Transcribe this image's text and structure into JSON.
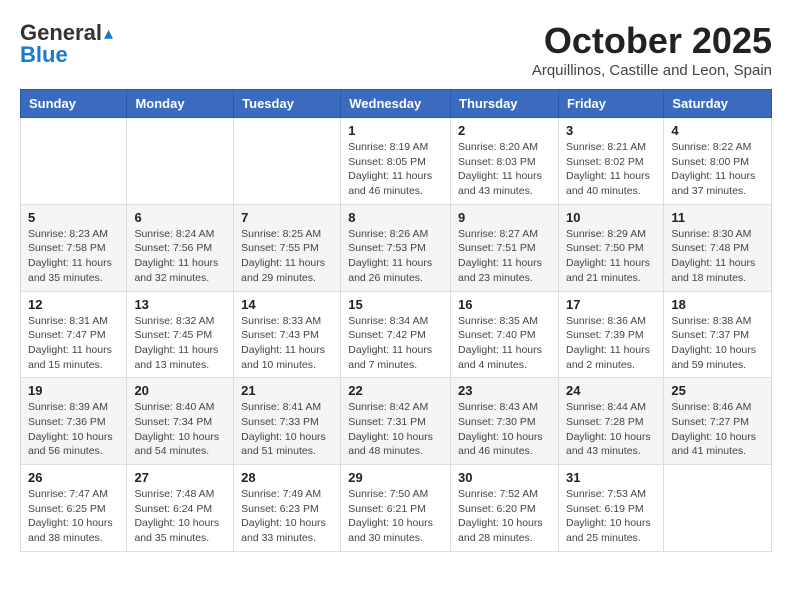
{
  "header": {
    "logo_general": "General",
    "logo_blue": "Blue",
    "month_title": "October 2025",
    "location": "Arquillinos, Castille and Leon, Spain"
  },
  "weekdays": [
    "Sunday",
    "Monday",
    "Tuesday",
    "Wednesday",
    "Thursday",
    "Friday",
    "Saturday"
  ],
  "weeks": [
    [
      {
        "day": "",
        "info": ""
      },
      {
        "day": "",
        "info": ""
      },
      {
        "day": "",
        "info": ""
      },
      {
        "day": "1",
        "info": "Sunrise: 8:19 AM\nSunset: 8:05 PM\nDaylight: 11 hours and 46 minutes."
      },
      {
        "day": "2",
        "info": "Sunrise: 8:20 AM\nSunset: 8:03 PM\nDaylight: 11 hours and 43 minutes."
      },
      {
        "day": "3",
        "info": "Sunrise: 8:21 AM\nSunset: 8:02 PM\nDaylight: 11 hours and 40 minutes."
      },
      {
        "day": "4",
        "info": "Sunrise: 8:22 AM\nSunset: 8:00 PM\nDaylight: 11 hours and 37 minutes."
      }
    ],
    [
      {
        "day": "5",
        "info": "Sunrise: 8:23 AM\nSunset: 7:58 PM\nDaylight: 11 hours and 35 minutes."
      },
      {
        "day": "6",
        "info": "Sunrise: 8:24 AM\nSunset: 7:56 PM\nDaylight: 11 hours and 32 minutes."
      },
      {
        "day": "7",
        "info": "Sunrise: 8:25 AM\nSunset: 7:55 PM\nDaylight: 11 hours and 29 minutes."
      },
      {
        "day": "8",
        "info": "Sunrise: 8:26 AM\nSunset: 7:53 PM\nDaylight: 11 hours and 26 minutes."
      },
      {
        "day": "9",
        "info": "Sunrise: 8:27 AM\nSunset: 7:51 PM\nDaylight: 11 hours and 23 minutes."
      },
      {
        "day": "10",
        "info": "Sunrise: 8:29 AM\nSunset: 7:50 PM\nDaylight: 11 hours and 21 minutes."
      },
      {
        "day": "11",
        "info": "Sunrise: 8:30 AM\nSunset: 7:48 PM\nDaylight: 11 hours and 18 minutes."
      }
    ],
    [
      {
        "day": "12",
        "info": "Sunrise: 8:31 AM\nSunset: 7:47 PM\nDaylight: 11 hours and 15 minutes."
      },
      {
        "day": "13",
        "info": "Sunrise: 8:32 AM\nSunset: 7:45 PM\nDaylight: 11 hours and 13 minutes."
      },
      {
        "day": "14",
        "info": "Sunrise: 8:33 AM\nSunset: 7:43 PM\nDaylight: 11 hours and 10 minutes."
      },
      {
        "day": "15",
        "info": "Sunrise: 8:34 AM\nSunset: 7:42 PM\nDaylight: 11 hours and 7 minutes."
      },
      {
        "day": "16",
        "info": "Sunrise: 8:35 AM\nSunset: 7:40 PM\nDaylight: 11 hours and 4 minutes."
      },
      {
        "day": "17",
        "info": "Sunrise: 8:36 AM\nSunset: 7:39 PM\nDaylight: 11 hours and 2 minutes."
      },
      {
        "day": "18",
        "info": "Sunrise: 8:38 AM\nSunset: 7:37 PM\nDaylight: 10 hours and 59 minutes."
      }
    ],
    [
      {
        "day": "19",
        "info": "Sunrise: 8:39 AM\nSunset: 7:36 PM\nDaylight: 10 hours and 56 minutes."
      },
      {
        "day": "20",
        "info": "Sunrise: 8:40 AM\nSunset: 7:34 PM\nDaylight: 10 hours and 54 minutes."
      },
      {
        "day": "21",
        "info": "Sunrise: 8:41 AM\nSunset: 7:33 PM\nDaylight: 10 hours and 51 minutes."
      },
      {
        "day": "22",
        "info": "Sunrise: 8:42 AM\nSunset: 7:31 PM\nDaylight: 10 hours and 48 minutes."
      },
      {
        "day": "23",
        "info": "Sunrise: 8:43 AM\nSunset: 7:30 PM\nDaylight: 10 hours and 46 minutes."
      },
      {
        "day": "24",
        "info": "Sunrise: 8:44 AM\nSunset: 7:28 PM\nDaylight: 10 hours and 43 minutes."
      },
      {
        "day": "25",
        "info": "Sunrise: 8:46 AM\nSunset: 7:27 PM\nDaylight: 10 hours and 41 minutes."
      }
    ],
    [
      {
        "day": "26",
        "info": "Sunrise: 7:47 AM\nSunset: 6:25 PM\nDaylight: 10 hours and 38 minutes."
      },
      {
        "day": "27",
        "info": "Sunrise: 7:48 AM\nSunset: 6:24 PM\nDaylight: 10 hours and 35 minutes."
      },
      {
        "day": "28",
        "info": "Sunrise: 7:49 AM\nSunset: 6:23 PM\nDaylight: 10 hours and 33 minutes."
      },
      {
        "day": "29",
        "info": "Sunrise: 7:50 AM\nSunset: 6:21 PM\nDaylight: 10 hours and 30 minutes."
      },
      {
        "day": "30",
        "info": "Sunrise: 7:52 AM\nSunset: 6:20 PM\nDaylight: 10 hours and 28 minutes."
      },
      {
        "day": "31",
        "info": "Sunrise: 7:53 AM\nSunset: 6:19 PM\nDaylight: 10 hours and 25 minutes."
      },
      {
        "day": "",
        "info": ""
      }
    ]
  ]
}
